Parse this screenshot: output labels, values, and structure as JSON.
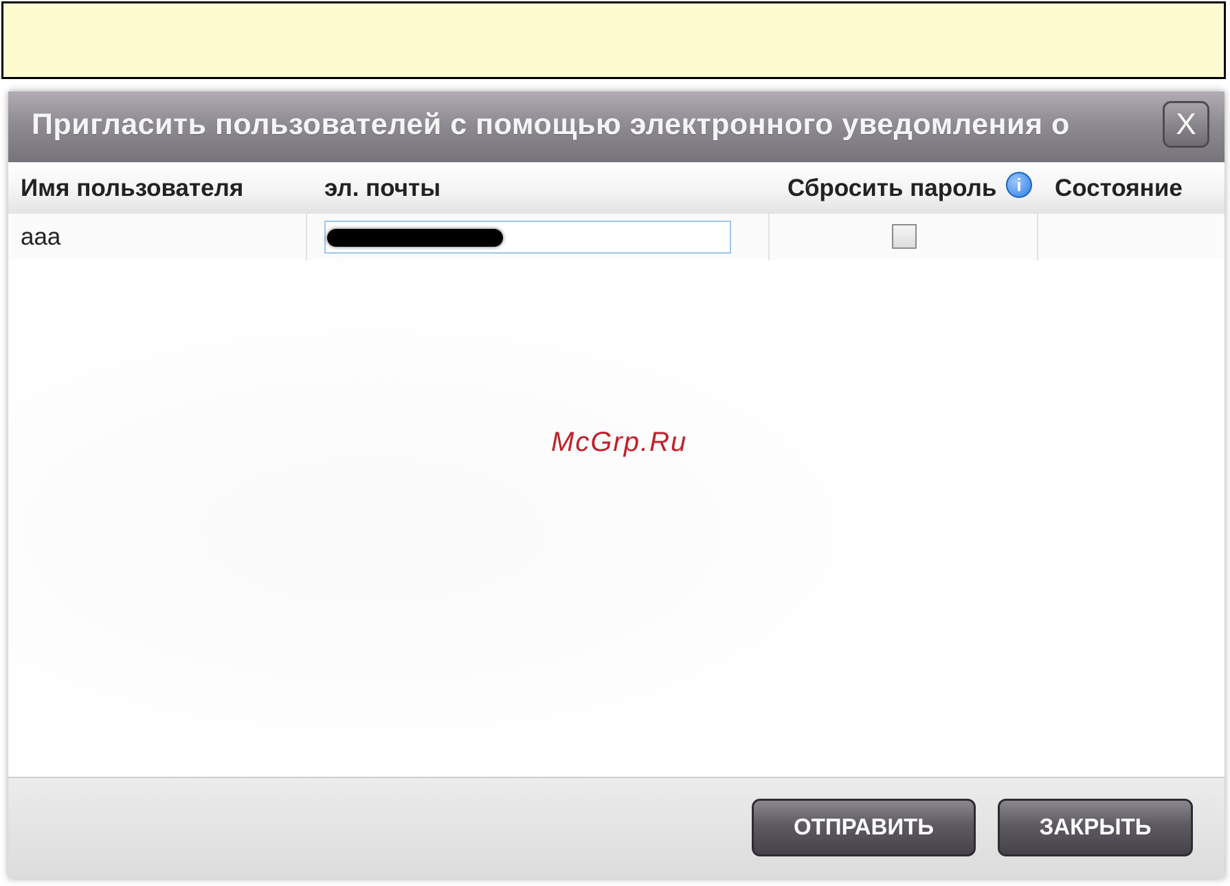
{
  "dialog": {
    "title": "Пригласить пользователей с помощью электронного уведомления о доступе к сервисам",
    "close_label": "X"
  },
  "table": {
    "headers": {
      "username": "Имя пользователя",
      "email": "эл. почты",
      "reset_password": "Сбросить пароль",
      "status": "Состояние"
    },
    "info_icon_label": "i",
    "rows": [
      {
        "username": "aaa",
        "email": "",
        "reset_password": false,
        "status": ""
      }
    ]
  },
  "watermark": "McGrp.Ru",
  "buttons": {
    "send": "ОТПРАВИТЬ",
    "close": "ЗАКРЫТЬ"
  }
}
